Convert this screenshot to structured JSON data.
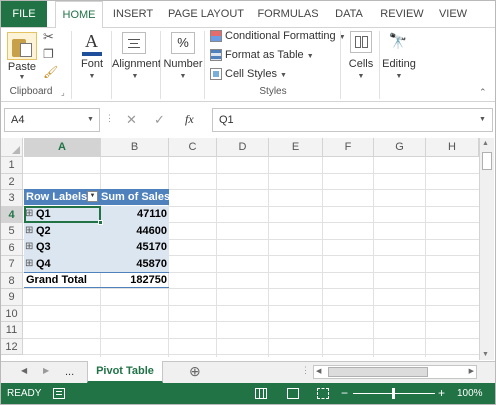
{
  "ribbon_tabs": [
    "FILE",
    "HOME",
    "INSERT",
    "PAGE LAYOUT",
    "FORMULAS",
    "DATA",
    "REVIEW",
    "VIEW"
  ],
  "clipboard": {
    "paste_label": "Paste",
    "group_label": "Clipboard"
  },
  "font_label": "Font",
  "alignment_label": "Alignment",
  "number_label": "Number",
  "percent_symbol": "%",
  "styles": {
    "conditional_formatting": "Conditional Formatting",
    "format_as_table": "Format as Table",
    "cell_styles": "Cell Styles",
    "group_label": "Styles"
  },
  "cells_label": "Cells",
  "editing_label": "Editing",
  "formula_bar": {
    "name_box": "A4",
    "fx": "fx",
    "content": "Q1"
  },
  "columns": [
    "A",
    "B",
    "C",
    "D",
    "E",
    "F",
    "G",
    "H"
  ],
  "selected_column": "A",
  "rows": [
    "1",
    "2",
    "3",
    "4",
    "5",
    "6",
    "7",
    "8",
    "9",
    "10",
    "11",
    "12"
  ],
  "selected_row": "4",
  "pivot": {
    "header_row_labels": "Row Labels",
    "header_sum": "Sum of Sales",
    "rows": [
      {
        "label": "Q1",
        "value": "47110"
      },
      {
        "label": "Q2",
        "value": "44600"
      },
      {
        "label": "Q3",
        "value": "45170"
      },
      {
        "label": "Q4",
        "value": "45870"
      }
    ],
    "grand_total_label": "Grand Total",
    "grand_total_value": "182750",
    "expand_symbol": "⊞"
  },
  "sheet_tabs": {
    "ellipsis": "...",
    "active": "Pivot Table",
    "add": "⊕"
  },
  "status": {
    "ready": "READY",
    "zoom": "100%",
    "minus": "−",
    "plus": "+"
  },
  "colors": {
    "excel_green": "#217346",
    "pivot_header": "#4f81bd",
    "pivot_band": "#dce6f1"
  }
}
